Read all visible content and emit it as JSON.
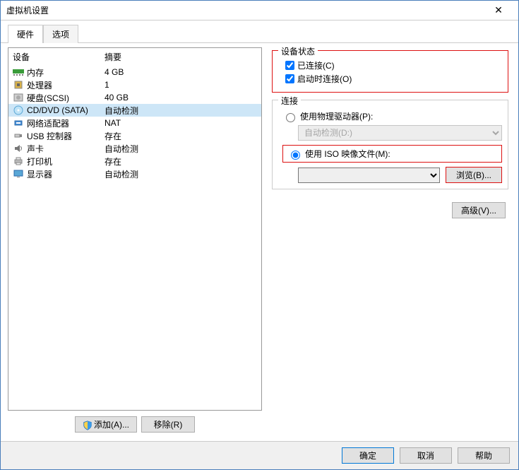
{
  "window": {
    "title": "虚拟机设置"
  },
  "tabs": {
    "hardware": "硬件",
    "options": "选项"
  },
  "headers": {
    "device": "设备",
    "summary": "摘要"
  },
  "devices": [
    {
      "icon": "memory",
      "name": "内存",
      "summary": "4 GB"
    },
    {
      "icon": "cpu",
      "name": "处理器",
      "summary": "1"
    },
    {
      "icon": "disk",
      "name": "硬盘(SCSI)",
      "summary": "40 GB"
    },
    {
      "icon": "cd",
      "name": "CD/DVD (SATA)",
      "summary": "自动检测",
      "selected": true
    },
    {
      "icon": "net",
      "name": "网络适配器",
      "summary": "NAT"
    },
    {
      "icon": "usb",
      "name": "USB 控制器",
      "summary": "存在"
    },
    {
      "icon": "sound",
      "name": "声卡",
      "summary": "自动检测"
    },
    {
      "icon": "printer",
      "name": "打印机",
      "summary": "存在"
    },
    {
      "icon": "display",
      "name": "显示器",
      "summary": "自动检测"
    }
  ],
  "buttons": {
    "add": "添加(A)...",
    "remove": "移除(R)",
    "browse": "浏览(B)...",
    "advanced": "高级(V)...",
    "ok": "确定",
    "cancel": "取消",
    "help": "帮助"
  },
  "groups": {
    "state_legend": "设备状态",
    "connected": "已连接(C)",
    "connect_on": "启动时连接(O)",
    "conn_legend": "连接",
    "use_physical": "使用物理驱动器(P):",
    "auto_detect": "自动检测(D:)",
    "use_iso": "使用 ISO 映像文件(M):"
  }
}
